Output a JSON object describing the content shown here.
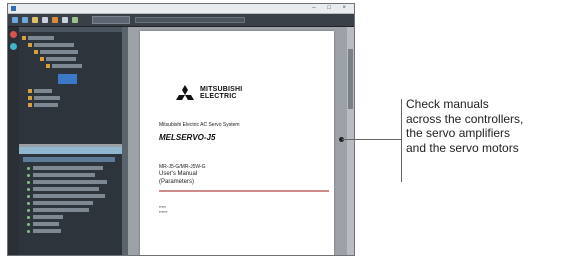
{
  "window": {
    "title": "",
    "controls": "–  □  ×"
  },
  "toolbar": {
    "tab_label": "",
    "address_text": ""
  },
  "document": {
    "logo_text": "MITSUBISHI\nELECTRIC",
    "subtitle": "Mitsubishi Electric AC Servo System",
    "brand": "MELSERVO-J5",
    "model": "MR-J5-G/MR-J5W-G",
    "title_line1": "User's Manual",
    "title_line2": "(Parameters)"
  },
  "callout": {
    "line1": "Check manuals",
    "line2": "across the controllers,",
    "line3": "the servo amplifiers",
    "line4": "and the servo motors"
  }
}
